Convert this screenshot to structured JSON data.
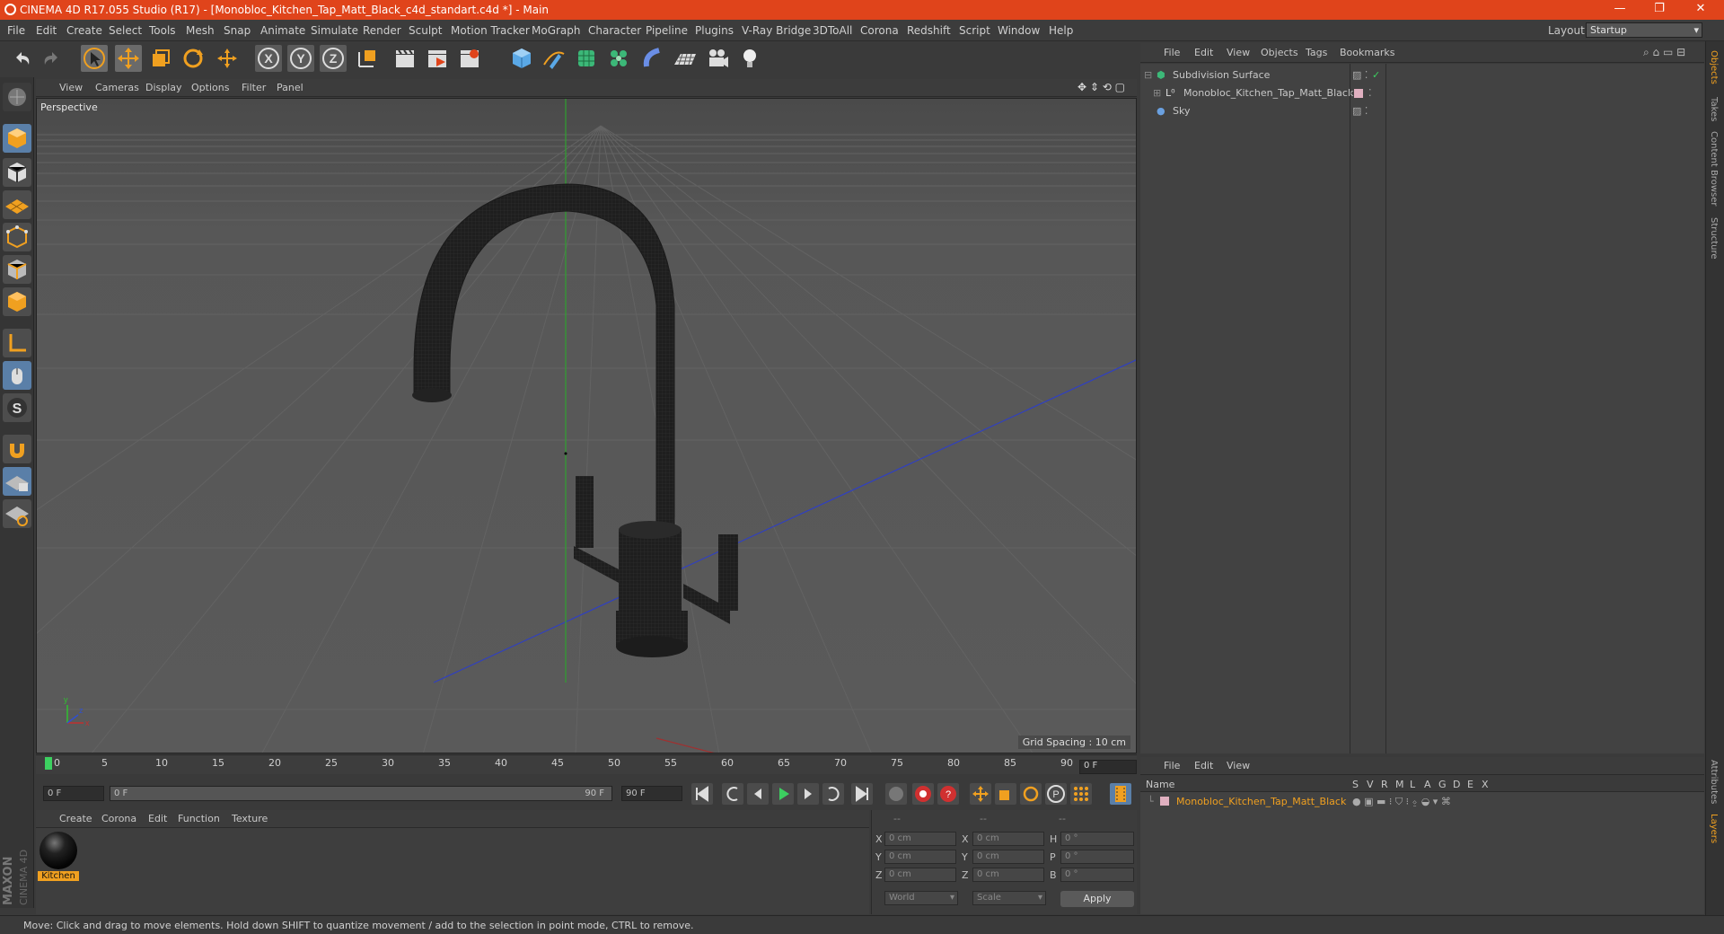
{
  "window": {
    "title": "CINEMA 4D R17.055 Studio (R17) - [Monobloc_Kitchen_Tap_Matt_Black_c4d_standart.c4d *] - Main",
    "minimize": "—",
    "maximize": "❐",
    "close": "✕"
  },
  "menubar": {
    "items": [
      "File",
      "Edit",
      "Create",
      "Select",
      "Tools",
      "Mesh",
      "Snap",
      "Animate",
      "Simulate",
      "Render",
      "Sculpt",
      "Motion Tracker",
      "MoGraph",
      "Character",
      "Pipeline",
      "Plugins",
      "V-Ray Bridge",
      "3DToAll",
      "Corona",
      "Redshift",
      "Script",
      "Window",
      "Help"
    ],
    "layout_label": "Layout:",
    "layout_value": "Startup"
  },
  "toolbar": {
    "axis_x": "X",
    "axis_y": "Y",
    "axis_z": "Z"
  },
  "viewport": {
    "menu": [
      "View",
      "Cameras",
      "Display",
      "Options",
      "Filter",
      "Panel"
    ],
    "camera_label": "Perspective",
    "grid_spacing": "Grid Spacing : 10 cm",
    "axis_x": "x",
    "axis_y": "y",
    "axis_z": "z"
  },
  "timeline": {
    "ticks": [
      "0",
      "5",
      "10",
      "15",
      "20",
      "25",
      "30",
      "35",
      "40",
      "45",
      "50",
      "55",
      "60",
      "65",
      "70",
      "75",
      "80",
      "85",
      "90"
    ],
    "current_frame": "0 F",
    "start_field": "0 F",
    "range_start": "0 F",
    "range_end": "90 F",
    "end_field": "90 F"
  },
  "material_manager": {
    "menu": [
      "Create",
      "Corona",
      "Edit",
      "Function",
      "Texture"
    ],
    "materials": [
      {
        "name": "Kitchen"
      }
    ]
  },
  "coordinates": {
    "header": [
      "--",
      "--",
      "--"
    ],
    "rows": [
      {
        "pos_label": "X",
        "pos": "0 cm",
        "size_label": "X",
        "size": "0 cm",
        "rot_label": "H",
        "rot": "0 °"
      },
      {
        "pos_label": "Y",
        "pos": "0 cm",
        "size_label": "Y",
        "size": "0 cm",
        "rot_label": "P",
        "rot": "0 °"
      },
      {
        "pos_label": "Z",
        "pos": "0 cm",
        "size_label": "Z",
        "size": "0 cm",
        "rot_label": "B",
        "rot": "0 °"
      }
    ],
    "mode1": "World",
    "mode2": "Scale",
    "apply": "Apply"
  },
  "object_manager": {
    "menu": [
      "File",
      "Edit",
      "View",
      "Objects",
      "Tags",
      "Bookmarks"
    ],
    "objects": [
      {
        "name": "Subdivision Surface"
      },
      {
        "name": "Monobloc_Kitchen_Tap_Matt_Black"
      },
      {
        "name": "Sky"
      }
    ]
  },
  "layers_manager": {
    "menu": [
      "File",
      "Edit",
      "View"
    ],
    "columns": [
      "Name",
      "S",
      "V",
      "R",
      "M",
      "L",
      "A",
      "G",
      "D",
      "E",
      "X"
    ],
    "layers": [
      {
        "name": "Monobloc_Kitchen_Tap_Matt_Black"
      }
    ]
  },
  "right_tabs": [
    "Objects",
    "Takes",
    "Content Browser",
    "Structure",
    "Attributes",
    "Layers"
  ],
  "maxon": {
    "line1": "MAXON",
    "line2": "CINEMA 4D"
  },
  "status": "Move: Click and drag to move elements. Hold down SHIFT to quantize movement / add to the selection in point mode, CTRL to remove.",
  "colors": {
    "accent": "#e0441b",
    "highlight": "#f0a020",
    "viewport_bg": "#555555"
  }
}
